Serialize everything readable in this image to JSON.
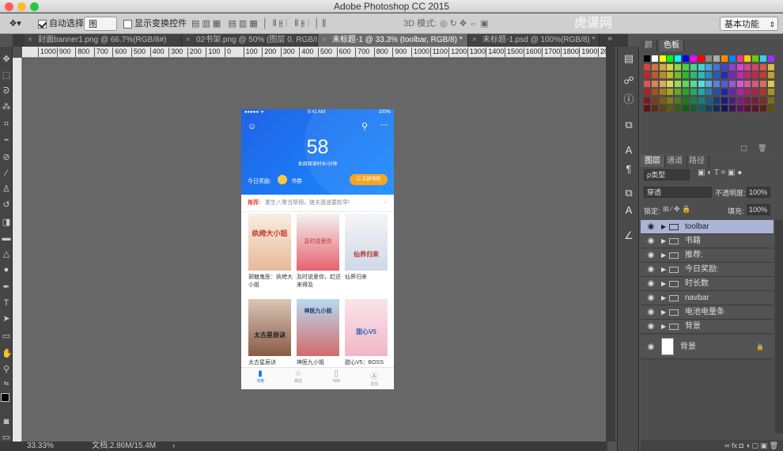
{
  "window": {
    "title": "Adobe Photoshop CC 2015",
    "watermark": "虎课网"
  },
  "options": {
    "auto_select_label": "自动选择:",
    "auto_select_value": "图层",
    "show_transform_label": "显示变换控件",
    "mode3d_label": "3D 模式:",
    "workspace": "基本功能"
  },
  "tabs": [
    {
      "label": "封面banner1.png @ 66.7%(RGB/8#)"
    },
    {
      "label": "02书架.png @ 50% (图层 0, RGB/8#)"
    },
    {
      "label": "未标题-1 @ 33.3% (toolbar, RGB/8) *"
    },
    {
      "label": "未标题-1.psd @ 100%(RGB/8) *"
    }
  ],
  "ruler_ticks": [
    "1000",
    "900",
    "800",
    "700",
    "600",
    "500",
    "400",
    "300",
    "200",
    "100",
    "0",
    "100",
    "200",
    "300",
    "400",
    "500",
    "600",
    "700",
    "800",
    "900",
    "1000",
    "1100",
    "1200",
    "1300",
    "1400",
    "1500",
    "1600",
    "1700",
    "1800",
    "1900",
    "2000"
  ],
  "status": {
    "zoom": "33.33%",
    "doc": "文档:2.86M/15.4M"
  },
  "panels": {
    "color_tabs": [
      "颜",
      "色板"
    ],
    "layer_tabs": [
      "图层",
      "通道",
      "路径"
    ],
    "filter_label": "ρ类型",
    "blend_mode": "穿透",
    "opacity_label": "不透明度:",
    "opacity_value": "100%",
    "lock_label": "锁定:",
    "fill_label": "填充:",
    "fill_value": "100%",
    "bottom_icons": "∞  fx  ◘  ◑  ▢  ▣  🗑"
  },
  "layers": [
    {
      "name": "toolbar",
      "selected": true
    },
    {
      "name": "书籍"
    },
    {
      "name": "推荐:"
    },
    {
      "name": "今日奖励:"
    },
    {
      "name": "时长数"
    },
    {
      "name": "navbar"
    },
    {
      "name": "电池电量条"
    },
    {
      "name": "背景"
    }
  ],
  "bg_layer": {
    "name": "背景",
    "lock": "🔒"
  },
  "phone": {
    "time": "9:41 AM",
    "battery": "100%",
    "carrier": "●●●●● ᯤ",
    "minutes": "58",
    "minutes_label": "本周阅读时长/分钟",
    "reward_label": "今日奖励:",
    "reward_value": "书券",
    "claim_button": "☑ 立即领取",
    "recommend_label": "推荐:",
    "recommend_text": "重生八零当帮佣，狼夫遗道要趁早!",
    "books": [
      {
        "title": "邪魅鬼医：纨绔大小姐",
        "cover_text": "纨绔大小姐"
      },
      {
        "title": "及时说爱你，赶还来得及",
        "cover_text": "及时说爱你"
      },
      {
        "title": "仙界归来",
        "cover_text": "仙界归来"
      },
      {
        "title": "太古星辰诀",
        "cover_text": "太古星辰诀"
      },
      {
        "title": "神医九小姐",
        "cover_text": "神医九小姐"
      },
      {
        "title": "甜心V5：BOSS",
        "cover_text": "甜心V5"
      }
    ],
    "tabs": [
      "书架",
      "精选",
      "书库",
      "发现"
    ]
  },
  "colors": {
    "accent": "#1a73f0",
    "layer_selected": "#a9b4d6",
    "orange": "#f5a623"
  }
}
